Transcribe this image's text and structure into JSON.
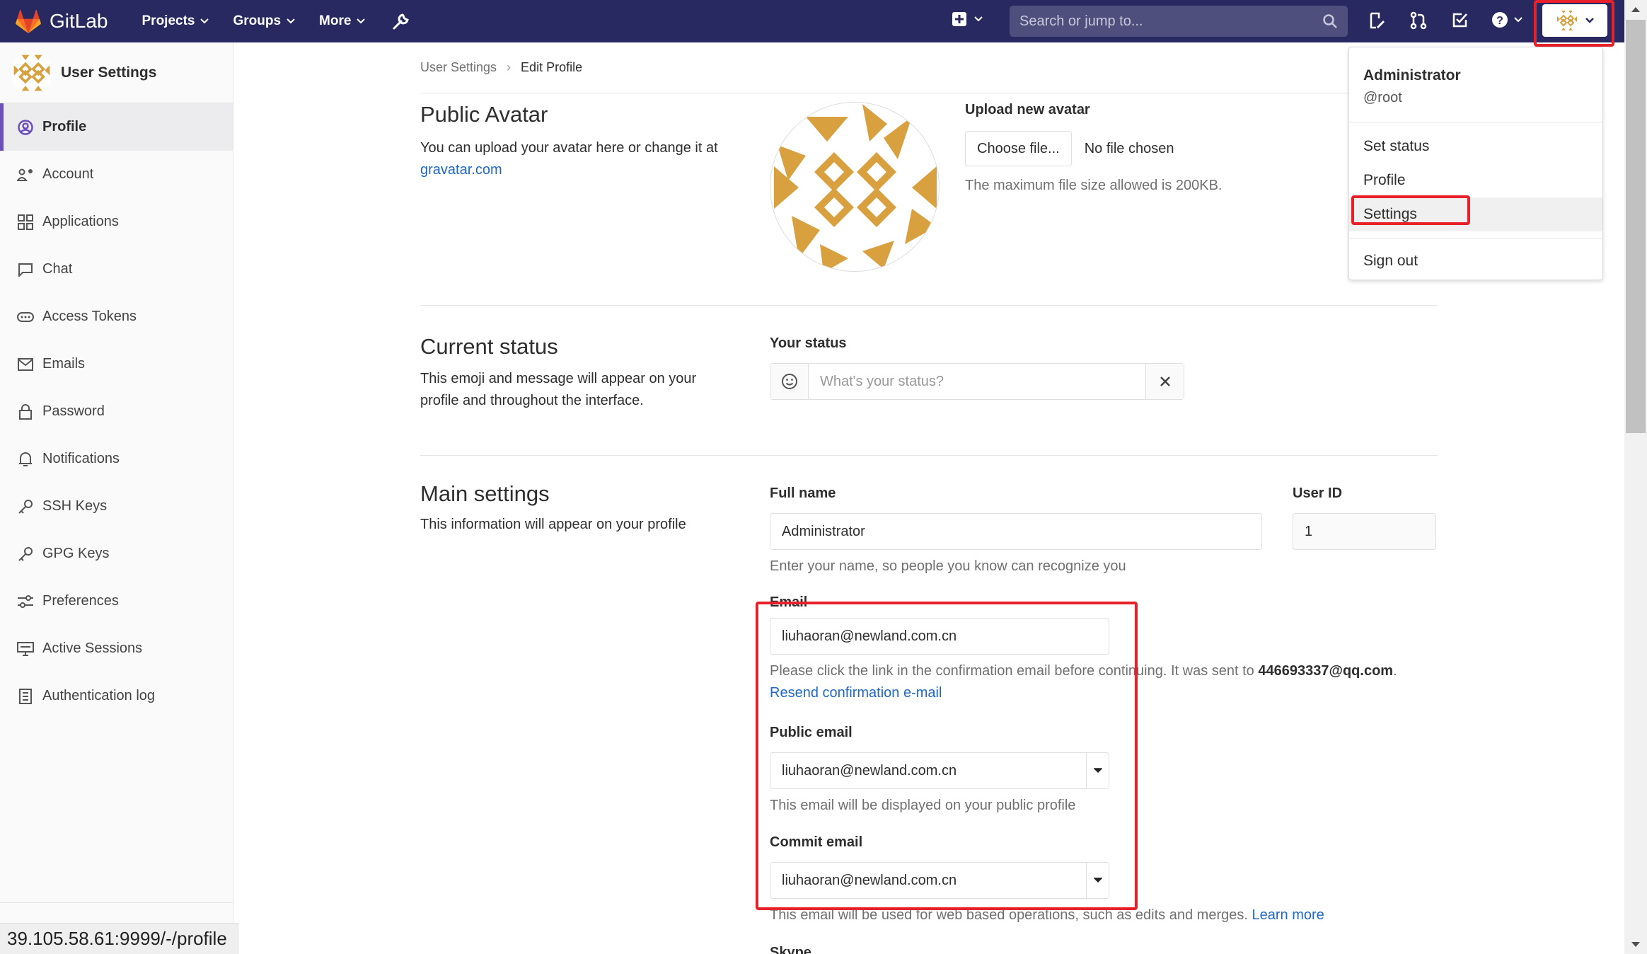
{
  "nav": {
    "brand": "GitLab",
    "menu": [
      {
        "label": "Projects"
      },
      {
        "label": "Groups"
      },
      {
        "label": "More"
      }
    ],
    "search_placeholder": "Search or jump to..."
  },
  "sidebar": {
    "title": "User Settings",
    "items": [
      {
        "label": "Profile",
        "icon": "profile-icon"
      },
      {
        "label": "Account",
        "icon": "account-icon"
      },
      {
        "label": "Applications",
        "icon": "applications-icon"
      },
      {
        "label": "Chat",
        "icon": "chat-icon"
      },
      {
        "label": "Access Tokens",
        "icon": "token-icon"
      },
      {
        "label": "Emails",
        "icon": "mail-icon"
      },
      {
        "label": "Password",
        "icon": "lock-icon"
      },
      {
        "label": "Notifications",
        "icon": "bell-icon"
      },
      {
        "label": "SSH Keys",
        "icon": "key-icon"
      },
      {
        "label": "GPG Keys",
        "icon": "key-icon"
      },
      {
        "label": "Preferences",
        "icon": "preferences-icon"
      },
      {
        "label": "Active Sessions",
        "icon": "monitor-icon"
      },
      {
        "label": "Authentication log",
        "icon": "log-icon"
      }
    ]
  },
  "breadcrumb": {
    "parent": "User Settings",
    "current": "Edit Profile"
  },
  "avatar_section": {
    "title": "Public Avatar",
    "desc": "You can upload your avatar here or change it at",
    "link": "gravatar.com",
    "upload_label": "Upload new avatar",
    "choose_button": "Choose file...",
    "no_file": "No file chosen",
    "max_size": "The maximum file size allowed is 200KB."
  },
  "status_section": {
    "title": "Current status",
    "desc": "This emoji and message will appear on your profile and throughout the interface.",
    "label": "Your status",
    "placeholder": "What's your status?"
  },
  "main_section": {
    "title": "Main settings",
    "desc": "This information will appear on your profile",
    "full_name_label": "Full name",
    "full_name_value": "Administrator",
    "full_name_help": "Enter your name, so people you know can recognize you",
    "user_id_label": "User ID",
    "user_id_value": "1",
    "email_label": "Email",
    "email_value": "liuhaoran@newland.com.cn",
    "email_help": "Please click the link in the confirmation email before continuing. It was sent to",
    "email_sent_to": "446693337@qq.com",
    "email_help_end": ".",
    "resend_link": "Resend confirmation e-mail",
    "public_email_label": "Public email",
    "public_email_value": "liuhaoran@newland.com.cn",
    "public_email_help": "This email will be displayed on your public profile",
    "commit_email_label": "Commit email",
    "commit_email_value": "liuhaoran@newland.com.cn",
    "commit_email_help": "This email will be used for web based operations, such as edits and merges.",
    "learn_more": "Learn more",
    "skype_label": "Skype"
  },
  "user_dropdown": {
    "name": "Administrator",
    "handle": "@root",
    "items": [
      {
        "label": "Set status"
      },
      {
        "label": "Profile"
      },
      {
        "label": "Settings"
      },
      {
        "label": "Sign out"
      }
    ]
  },
  "status_url": "39.105.58.61:9999/-/profile",
  "colors": {
    "nav_bg": "#292961",
    "accent": "#6b4fbb",
    "link": "#1f68c4",
    "highlight": "#e8202a",
    "avatar": "#d9a03f"
  }
}
